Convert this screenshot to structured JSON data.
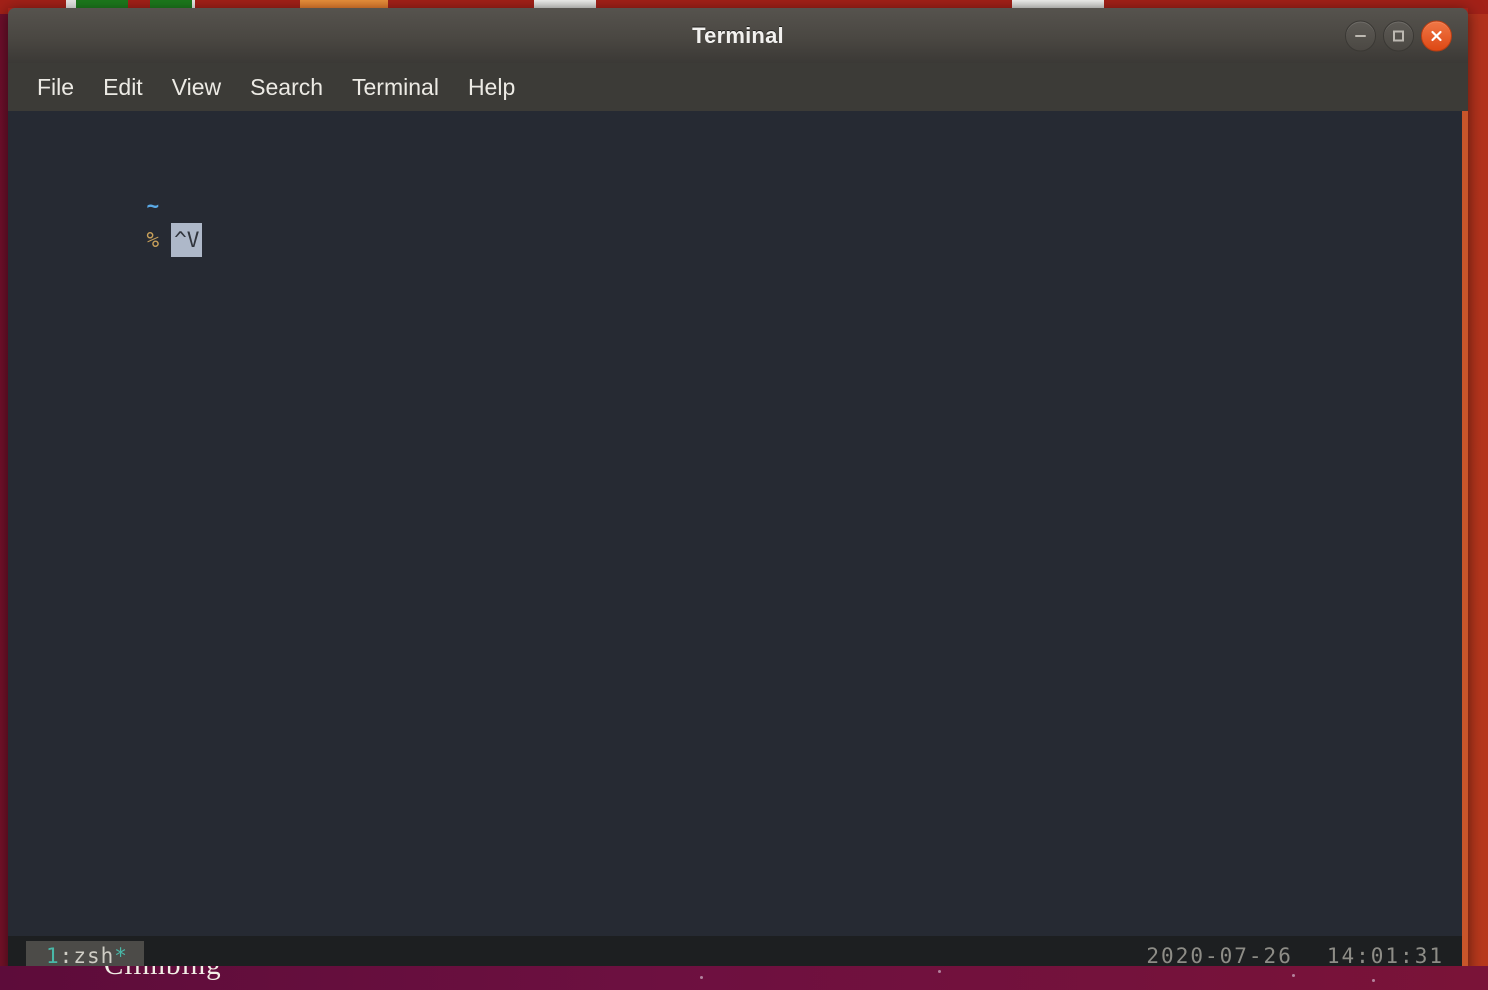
{
  "window": {
    "title": "Terminal",
    "controls": [
      {
        "name": "minimize",
        "glyph": "minus"
      },
      {
        "name": "maximize",
        "glyph": "square"
      },
      {
        "name": "close",
        "glyph": "cross"
      }
    ]
  },
  "menubar": {
    "items": [
      {
        "label": "File"
      },
      {
        "label": "Edit"
      },
      {
        "label": "View"
      },
      {
        "label": "Search"
      },
      {
        "label": "Terminal"
      },
      {
        "label": "Help"
      }
    ]
  },
  "terminal": {
    "lines": [
      {
        "tilde": "~"
      },
      {
        "prompt": "%",
        "cursor_text": "^V"
      }
    ]
  },
  "status_bar": {
    "window_index": "1",
    "separator": ":",
    "window_name": "zsh",
    "active_flag": "*",
    "date": "2020-07-26",
    "time": "14:01:31"
  },
  "desktop": {
    "clipped_text": "Climbing"
  },
  "colors": {
    "accent_orange": "#dd4814",
    "terminal_bg": "#262a33",
    "titlebar": "#4a4742",
    "menubar": "#3c3b37",
    "status_bg": "#1d1f21",
    "cursor": "#aeb8c9",
    "tmux_teal": "#49b8a8",
    "prompt_gold": "#c8a05a",
    "tilde_blue": "#5aa9e6",
    "desktop_red": "#8c1a22",
    "border_orange": "#c8552a"
  }
}
